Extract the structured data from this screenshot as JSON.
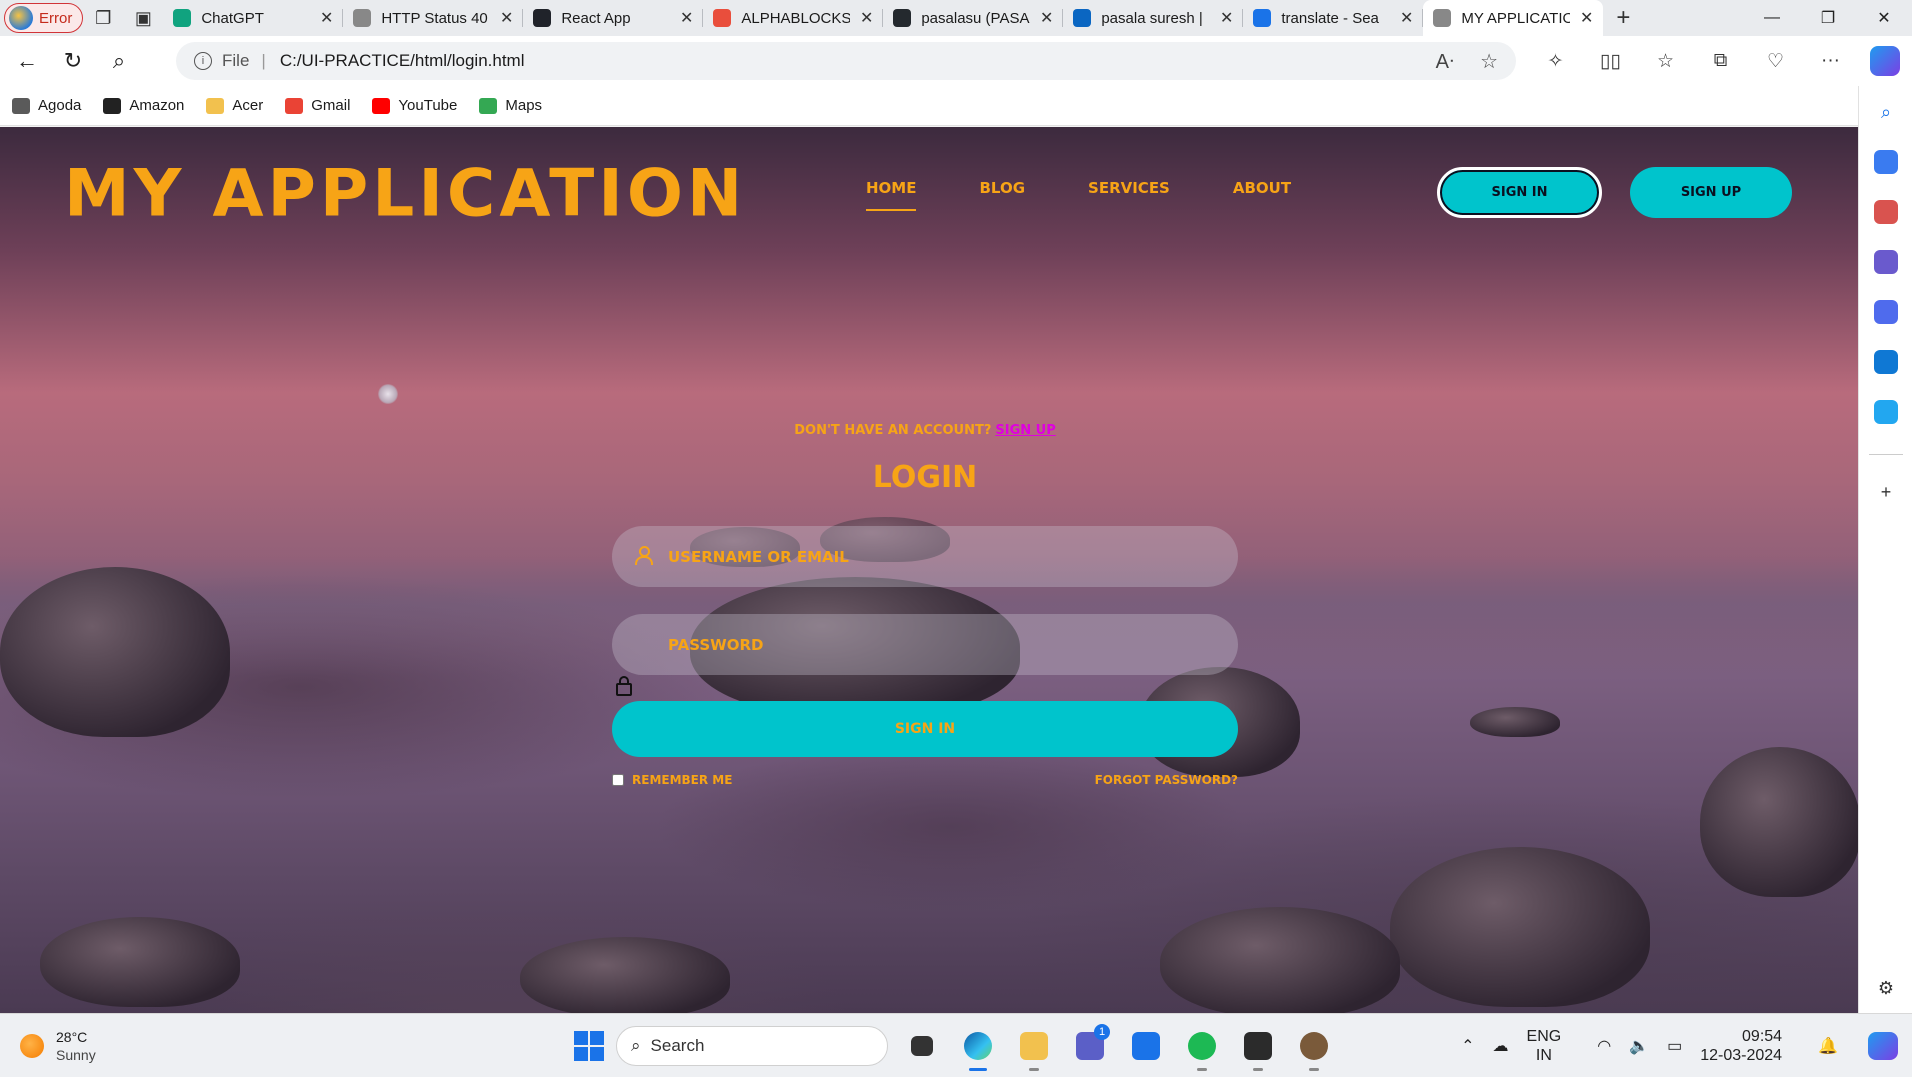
{
  "browser": {
    "tabs": [
      {
        "title": "ChatGPT",
        "icon": "chatgpt-icon",
        "color": "#10a37f"
      },
      {
        "title": "HTTP Status 40",
        "icon": "page-icon",
        "color": "#888888"
      },
      {
        "title": "React App",
        "icon": "react-icon",
        "color": "#20232a"
      },
      {
        "title": "ALPHABLOCKS",
        "icon": "alphablocks-icon",
        "color": "#e94e3c"
      },
      {
        "title": "pasalasu (PASA",
        "icon": "github-icon",
        "color": "#24292e"
      },
      {
        "title": "pasala suresh |",
        "icon": "linkedin-icon",
        "color": "#0a66c2"
      },
      {
        "title": "translate - Sea",
        "icon": "search-icon",
        "color": "#1a73e8"
      },
      {
        "title": "MY APPLICATIO",
        "icon": "page-icon",
        "color": "#888888"
      }
    ],
    "error_label": "Error",
    "address": {
      "scheme_label": "File",
      "url": "C:/UI-PRACTICE/html/login.html"
    },
    "bookmarks": [
      {
        "label": "Agoda",
        "color": "#5a5a5a"
      },
      {
        "label": "Amazon",
        "color": "#222222"
      },
      {
        "label": "Acer",
        "color": "#f2c14e"
      },
      {
        "label": "Gmail",
        "color": "#ea4335"
      },
      {
        "label": "YouTube",
        "color": "#ff0000"
      },
      {
        "label": "Maps",
        "color": "#34a853"
      }
    ]
  },
  "site": {
    "logo": "My Application",
    "nav": [
      "Home",
      "Blog",
      "Services",
      "About"
    ],
    "active_nav": "Home",
    "header_signin": "Sign In",
    "header_signup": "Sign Up",
    "accent_color": "#f7a416",
    "button_color": "#00c4cc"
  },
  "login": {
    "prompt": "Don't have an account?",
    "prompt_link": "Sign up",
    "title": "Login",
    "username_placeholder": "Username or Email",
    "password_placeholder": "Password",
    "submit": "Sign In",
    "remember": "Remember Me",
    "forgot": "Forgot Password?"
  },
  "taskbar": {
    "weather_temp": "28°C",
    "weather_desc": "Sunny",
    "search_label": "Search",
    "teams_badge": "1",
    "lang_line1": "ENG",
    "lang_line2": "IN",
    "time": "09:54",
    "date": "12-03-2024"
  }
}
